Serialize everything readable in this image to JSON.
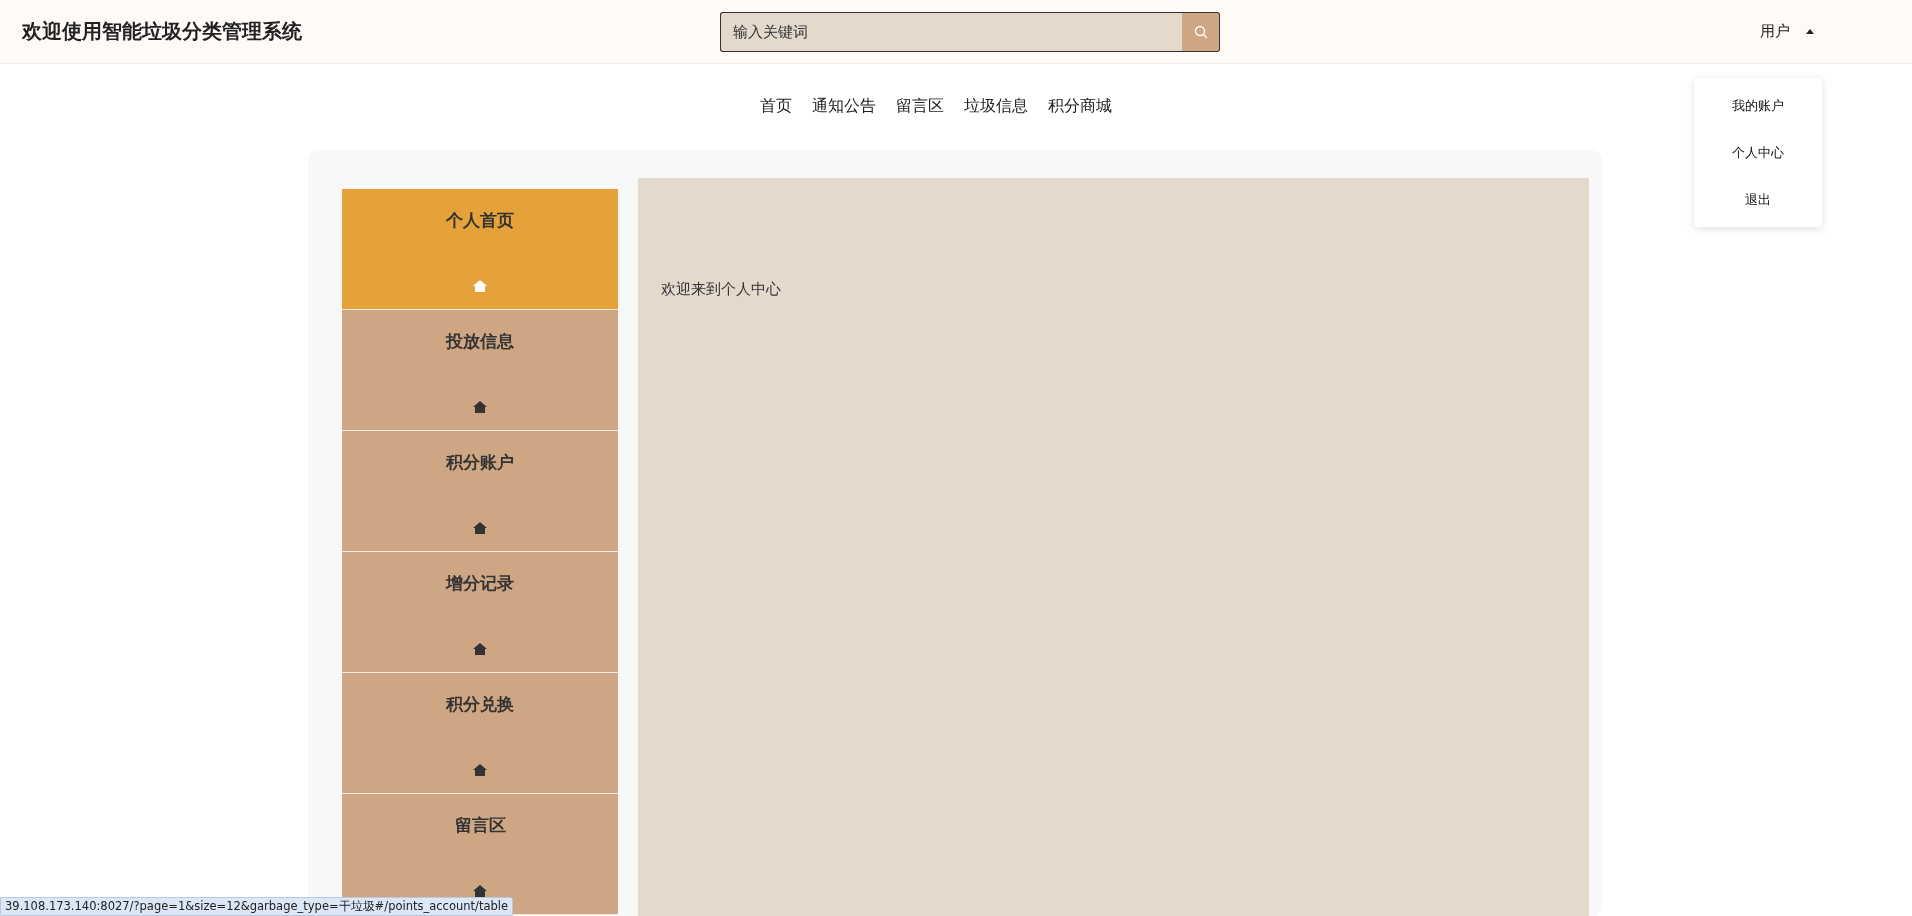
{
  "header": {
    "title": "欢迎使用智能垃圾分类管理系统",
    "search": {
      "placeholder": "输入关键词"
    },
    "user": {
      "label": "用户",
      "expanded": true
    }
  },
  "user_menu": [
    {
      "label": "我的账户"
    },
    {
      "label": "个人中心"
    },
    {
      "label": "退出"
    }
  ],
  "nav": [
    {
      "label": "首页"
    },
    {
      "label": "通知公告"
    },
    {
      "label": "留言区"
    },
    {
      "label": "垃圾信息"
    },
    {
      "label": "积分商城"
    }
  ],
  "sidebar": {
    "items": [
      {
        "label": "个人首页",
        "selected": true
      },
      {
        "label": "投放信息",
        "selected": false
      },
      {
        "label": "积分账户",
        "selected": false
      },
      {
        "label": "增分记录",
        "selected": false
      },
      {
        "label": "积分兑换",
        "selected": false
      },
      {
        "label": "留言区",
        "selected": false
      }
    ]
  },
  "content": {
    "text": "欢迎来到个人中心"
  },
  "status_bar": {
    "url": "39.108.173.140:8027/?page=1&size=12&garbage_type=干垃圾#/points_account/table"
  }
}
